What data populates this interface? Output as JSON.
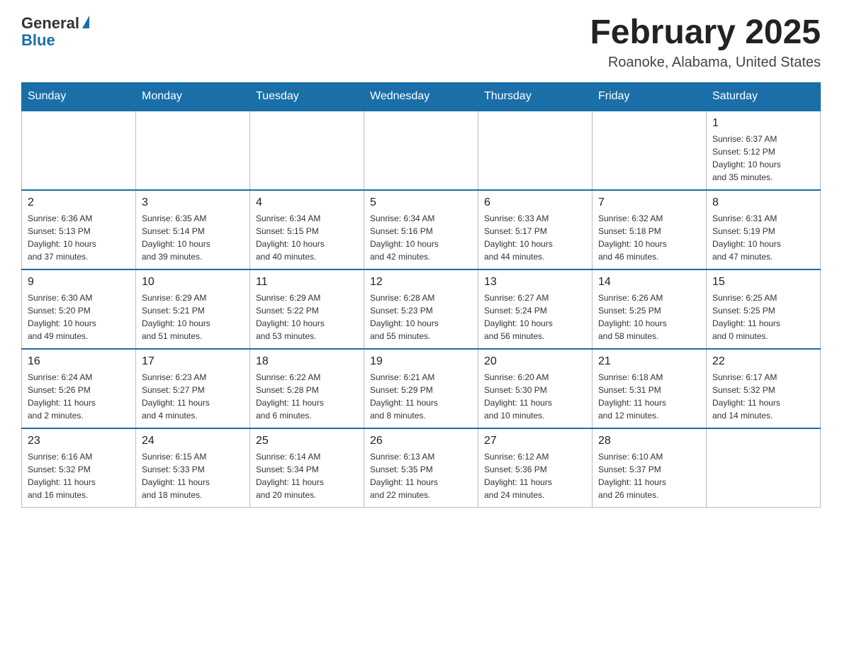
{
  "header": {
    "logo": {
      "general": "General",
      "blue": "Blue"
    },
    "title": "February 2025",
    "subtitle": "Roanoke, Alabama, United States"
  },
  "days_of_week": [
    "Sunday",
    "Monday",
    "Tuesday",
    "Wednesday",
    "Thursday",
    "Friday",
    "Saturday"
  ],
  "weeks": [
    {
      "days": [
        {
          "number": "",
          "info": ""
        },
        {
          "number": "",
          "info": ""
        },
        {
          "number": "",
          "info": ""
        },
        {
          "number": "",
          "info": ""
        },
        {
          "number": "",
          "info": ""
        },
        {
          "number": "",
          "info": ""
        },
        {
          "number": "1",
          "info": "Sunrise: 6:37 AM\nSunset: 5:12 PM\nDaylight: 10 hours\nand 35 minutes."
        }
      ]
    },
    {
      "days": [
        {
          "number": "2",
          "info": "Sunrise: 6:36 AM\nSunset: 5:13 PM\nDaylight: 10 hours\nand 37 minutes."
        },
        {
          "number": "3",
          "info": "Sunrise: 6:35 AM\nSunset: 5:14 PM\nDaylight: 10 hours\nand 39 minutes."
        },
        {
          "number": "4",
          "info": "Sunrise: 6:34 AM\nSunset: 5:15 PM\nDaylight: 10 hours\nand 40 minutes."
        },
        {
          "number": "5",
          "info": "Sunrise: 6:34 AM\nSunset: 5:16 PM\nDaylight: 10 hours\nand 42 minutes."
        },
        {
          "number": "6",
          "info": "Sunrise: 6:33 AM\nSunset: 5:17 PM\nDaylight: 10 hours\nand 44 minutes."
        },
        {
          "number": "7",
          "info": "Sunrise: 6:32 AM\nSunset: 5:18 PM\nDaylight: 10 hours\nand 46 minutes."
        },
        {
          "number": "8",
          "info": "Sunrise: 6:31 AM\nSunset: 5:19 PM\nDaylight: 10 hours\nand 47 minutes."
        }
      ]
    },
    {
      "days": [
        {
          "number": "9",
          "info": "Sunrise: 6:30 AM\nSunset: 5:20 PM\nDaylight: 10 hours\nand 49 minutes."
        },
        {
          "number": "10",
          "info": "Sunrise: 6:29 AM\nSunset: 5:21 PM\nDaylight: 10 hours\nand 51 minutes."
        },
        {
          "number": "11",
          "info": "Sunrise: 6:29 AM\nSunset: 5:22 PM\nDaylight: 10 hours\nand 53 minutes."
        },
        {
          "number": "12",
          "info": "Sunrise: 6:28 AM\nSunset: 5:23 PM\nDaylight: 10 hours\nand 55 minutes."
        },
        {
          "number": "13",
          "info": "Sunrise: 6:27 AM\nSunset: 5:24 PM\nDaylight: 10 hours\nand 56 minutes."
        },
        {
          "number": "14",
          "info": "Sunrise: 6:26 AM\nSunset: 5:25 PM\nDaylight: 10 hours\nand 58 minutes."
        },
        {
          "number": "15",
          "info": "Sunrise: 6:25 AM\nSunset: 5:25 PM\nDaylight: 11 hours\nand 0 minutes."
        }
      ]
    },
    {
      "days": [
        {
          "number": "16",
          "info": "Sunrise: 6:24 AM\nSunset: 5:26 PM\nDaylight: 11 hours\nand 2 minutes."
        },
        {
          "number": "17",
          "info": "Sunrise: 6:23 AM\nSunset: 5:27 PM\nDaylight: 11 hours\nand 4 minutes."
        },
        {
          "number": "18",
          "info": "Sunrise: 6:22 AM\nSunset: 5:28 PM\nDaylight: 11 hours\nand 6 minutes."
        },
        {
          "number": "19",
          "info": "Sunrise: 6:21 AM\nSunset: 5:29 PM\nDaylight: 11 hours\nand 8 minutes."
        },
        {
          "number": "20",
          "info": "Sunrise: 6:20 AM\nSunset: 5:30 PM\nDaylight: 11 hours\nand 10 minutes."
        },
        {
          "number": "21",
          "info": "Sunrise: 6:18 AM\nSunset: 5:31 PM\nDaylight: 11 hours\nand 12 minutes."
        },
        {
          "number": "22",
          "info": "Sunrise: 6:17 AM\nSunset: 5:32 PM\nDaylight: 11 hours\nand 14 minutes."
        }
      ]
    },
    {
      "days": [
        {
          "number": "23",
          "info": "Sunrise: 6:16 AM\nSunset: 5:32 PM\nDaylight: 11 hours\nand 16 minutes."
        },
        {
          "number": "24",
          "info": "Sunrise: 6:15 AM\nSunset: 5:33 PM\nDaylight: 11 hours\nand 18 minutes."
        },
        {
          "number": "25",
          "info": "Sunrise: 6:14 AM\nSunset: 5:34 PM\nDaylight: 11 hours\nand 20 minutes."
        },
        {
          "number": "26",
          "info": "Sunrise: 6:13 AM\nSunset: 5:35 PM\nDaylight: 11 hours\nand 22 minutes."
        },
        {
          "number": "27",
          "info": "Sunrise: 6:12 AM\nSunset: 5:36 PM\nDaylight: 11 hours\nand 24 minutes."
        },
        {
          "number": "28",
          "info": "Sunrise: 6:10 AM\nSunset: 5:37 PM\nDaylight: 11 hours\nand 26 minutes."
        },
        {
          "number": "",
          "info": ""
        }
      ]
    }
  ]
}
